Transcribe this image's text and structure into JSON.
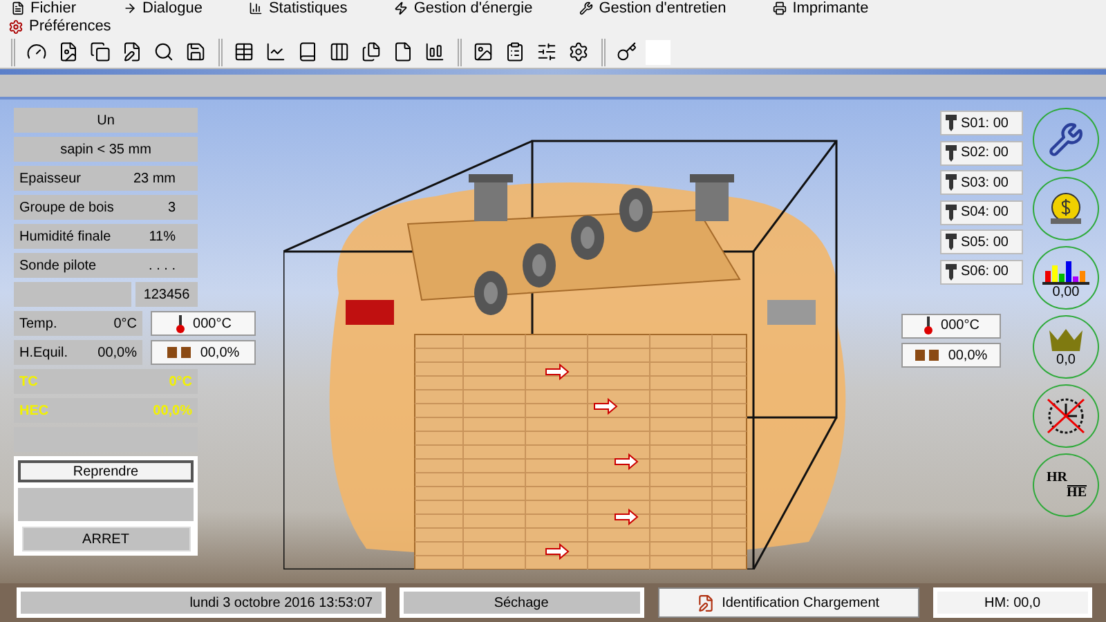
{
  "menu": [
    {
      "label": "Fichier",
      "kind": "file"
    },
    {
      "label": "Dialogue",
      "kind": "arrow"
    },
    {
      "label": "Statistiques",
      "kind": "stats"
    },
    {
      "label": "Gestion d'énergie",
      "kind": "energy"
    },
    {
      "label": "Gestion d'entretien",
      "kind": "maintenance"
    },
    {
      "label": "Imprimante",
      "kind": "printer"
    }
  ],
  "preferences": "Préférences",
  "panel": {
    "title": "Un",
    "species": "sapin < 35 mm",
    "fields": [
      {
        "label": "Epaisseur",
        "value": "23 mm"
      },
      {
        "label": "Groupe de bois",
        "value": "3"
      },
      {
        "label": "Humidité finale",
        "value": "11%"
      },
      {
        "label": "Sonde pilote",
        "value": ". . . ."
      }
    ],
    "code": "123456",
    "readings": [
      {
        "kind": "temperature",
        "label": "Temp.",
        "value": "0°C",
        "setpoint": "000°C"
      },
      {
        "kind": "humidity",
        "label": "H.Equil.",
        "value": "00,0%",
        "setpoint": "00,0%"
      }
    ],
    "computed": [
      {
        "label": "TC",
        "value": "0°C"
      },
      {
        "label": "HEC",
        "value": "00,0%"
      }
    ],
    "resume_button": "Reprendre",
    "stop_button": "ARRET"
  },
  "sensors": [
    {
      "label": "S01: 00"
    },
    {
      "label": "S02: 00"
    },
    {
      "label": "S03: 00"
    },
    {
      "label": "S04: 00"
    },
    {
      "label": "S05: 00"
    },
    {
      "label": "S06: 00"
    }
  ],
  "right_setpoints": [
    {
      "kind": "temperature",
      "value": "000°C"
    },
    {
      "kind": "humidity",
      "value": "00,0%"
    }
  ],
  "gauges": [
    {
      "kind": "wrench"
    },
    {
      "kind": "coin"
    },
    {
      "kind": "chart",
      "value": "0,00"
    },
    {
      "kind": "crown",
      "value": "0,0"
    },
    {
      "kind": "clock"
    },
    {
      "kind": "ratio",
      "top": "HR",
      "bottom": "HE"
    }
  ],
  "status_bar": {
    "date": "lundi 3 octobre 2016 13:53:07",
    "phase": "Séchage",
    "id_button": "Identification Chargement",
    "hm": "HM: 00,0"
  }
}
